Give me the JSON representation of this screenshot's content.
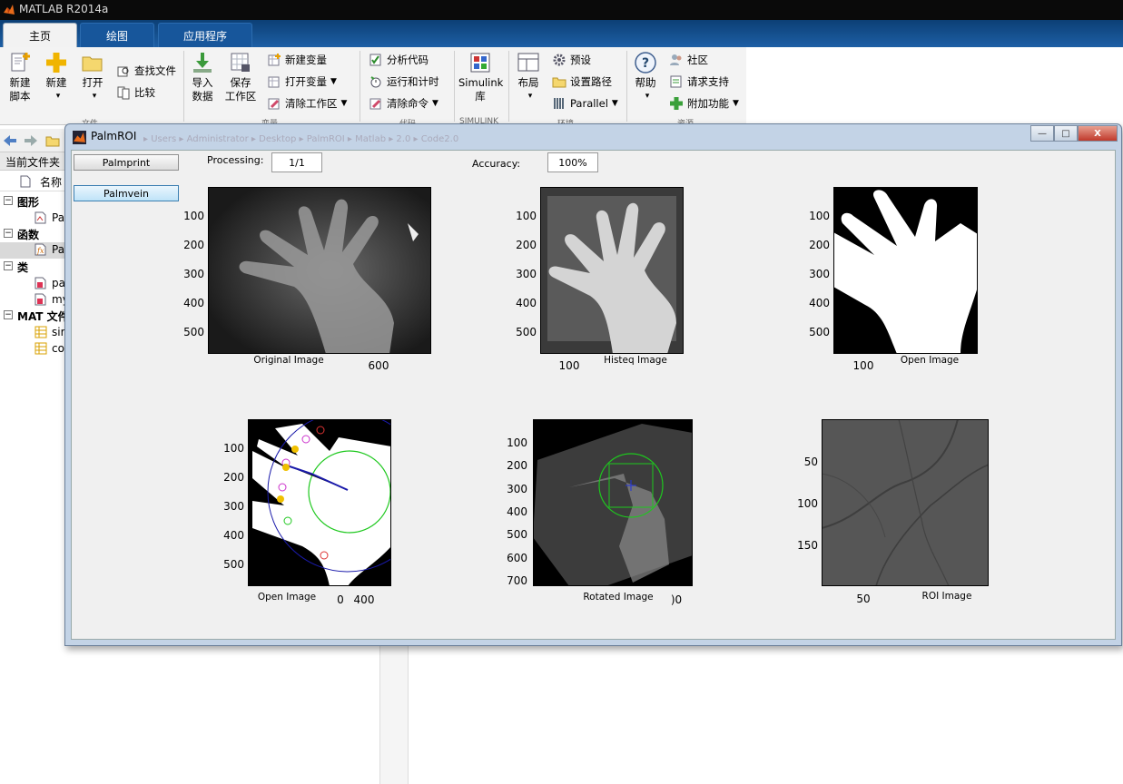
{
  "app": {
    "title": "MATLAB R2014a"
  },
  "tabs": [
    {
      "label": "主页"
    },
    {
      "label": "绘图"
    },
    {
      "label": "应用程序"
    }
  ],
  "toolstrip": {
    "new_script": "新建\n脚本",
    "new": "新建",
    "open": "打开",
    "find_files": "查找文件",
    "compare": "比较",
    "import_data": "导入\n数据",
    "save_workspace": "保存\n工作区",
    "new_variable": "新建变量",
    "open_variable": "打开变量",
    "clear_workspace": "清除工作区",
    "analyze_code": "分析代码",
    "run_and_time": "运行和计时",
    "clear_commands": "清除命令",
    "simulink": "Simulink\n库",
    "layout": "布局",
    "preferences": "预设",
    "set_path": "设置路径",
    "parallel": "Parallel",
    "help": "帮助",
    "community": "社区",
    "request_support": "请求支持",
    "addons": "附加功能",
    "sections": [
      "文件",
      "变量",
      "代码",
      "SIMULINK",
      "环境",
      "资源"
    ]
  },
  "breadcrumb": "▸ Users ▸ Administrator ▸ Desktop ▸ PalmROI ▸ Matlab ▸ 2.0 ▸ Code2.0",
  "file_browser": {
    "title": "当前文件夹",
    "col_name": "名称",
    "groups": [
      {
        "label": "图形",
        "items": [
          "Pa"
        ]
      },
      {
        "label": "函数",
        "items": [
          "Pa"
        ]
      },
      {
        "label": "类",
        "items": [
          "pa",
          "my"
        ]
      },
      {
        "label": "MAT 文件",
        "items": [
          "sir",
          "co"
        ]
      }
    ]
  },
  "figure": {
    "title": "PalmROI",
    "palmprint_button": "Palmprint",
    "palmvein_button": "Palmvein",
    "processing_label": "Processing:",
    "processing_value": "1/1",
    "accuracy_label": "Accuracy:",
    "accuracy_value": "100%",
    "window_buttons": {
      "minimize": "—",
      "maximize": "□",
      "close": "X"
    },
    "plots": [
      {
        "title": "Original Image",
        "yticks": [
          "100",
          "200",
          "300",
          "400",
          "500"
        ],
        "xticks": [
          "600"
        ]
      },
      {
        "title": "Histeq Image",
        "yticks": [
          "100",
          "200",
          "300",
          "400",
          "500"
        ],
        "xticks": [
          "100"
        ]
      },
      {
        "title": "Open Image",
        "yticks": [
          "100",
          "200",
          "300",
          "400",
          "500"
        ],
        "xticks": [
          "100"
        ]
      },
      {
        "title": "Open Image",
        "yticks": [
          "100",
          "200",
          "300",
          "400",
          "500"
        ],
        "xticks": [
          "0",
          "400"
        ]
      },
      {
        "title": "Rotated Image",
        "yticks": [
          "100",
          "200",
          "300",
          "400",
          "500",
          "600",
          "700"
        ],
        "xticks": [
          ")0"
        ]
      },
      {
        "title": "ROI Image",
        "yticks": [
          "50",
          "100",
          "150"
        ],
        "xticks": [
          "50"
        ]
      }
    ]
  }
}
